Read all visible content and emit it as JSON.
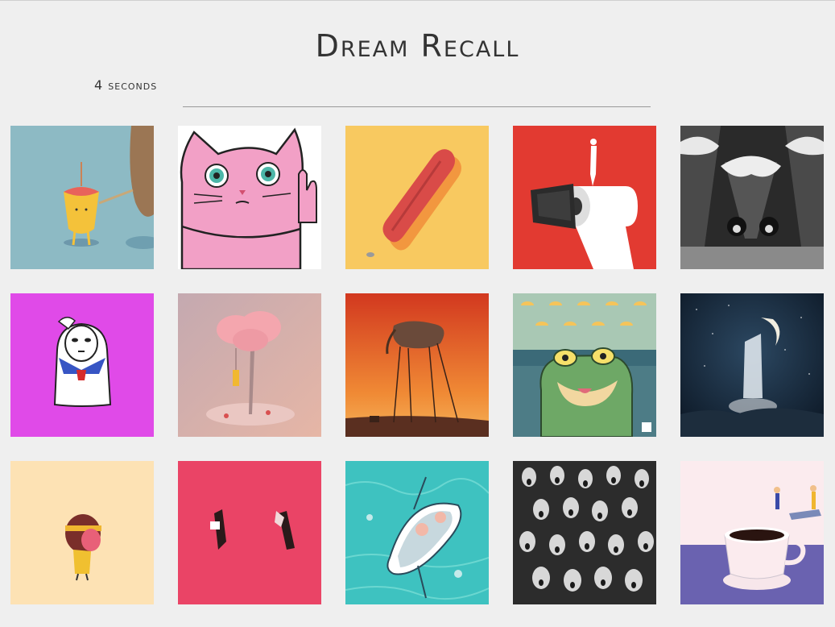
{
  "header": {
    "title": "Dream Recall",
    "timer": "4 seconds"
  },
  "grid": {
    "tiles": [
      {
        "name": "tile-yellow-creature",
        "bg": "#8dbac4"
      },
      {
        "name": "tile-pink-cat",
        "bg": "#ffffff"
      },
      {
        "name": "tile-sausage",
        "bg": "#f8c960"
      },
      {
        "name": "tile-toilet-paper",
        "bg": "#e23a31"
      },
      {
        "name": "tile-ice-cream-cartoon",
        "bg": "#2a2a2a"
      },
      {
        "name": "tile-no-face-sailor",
        "bg": "#e04ae8"
      },
      {
        "name": "tile-pink-tree",
        "bg": "#d4b2b2"
      },
      {
        "name": "tile-elephant-painting",
        "bg": "#e2582b"
      },
      {
        "name": "tile-frog",
        "bg": "#4d7c86"
      },
      {
        "name": "tile-moon-waterfall",
        "bg": "#182a40"
      },
      {
        "name": "tile-girl-headband",
        "bg": "#fde2b4"
      },
      {
        "name": "tile-two-figures",
        "bg": "#ea4466"
      },
      {
        "name": "tile-rowboat",
        "bg": "#3ec2c0"
      },
      {
        "name": "tile-crowd-faces",
        "bg": "#2c2c2c"
      },
      {
        "name": "tile-coffee-cup",
        "bg": "#fbebee"
      }
    ]
  }
}
